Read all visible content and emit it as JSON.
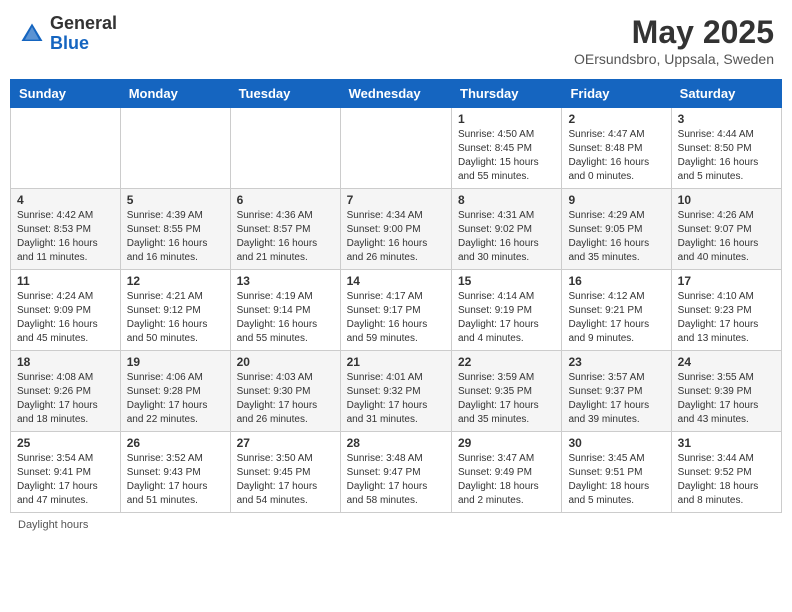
{
  "header": {
    "logo_general": "General",
    "logo_blue": "Blue",
    "month_year": "May 2025",
    "location": "OErsundsbro, Uppsala, Sweden"
  },
  "days_of_week": [
    "Sunday",
    "Monday",
    "Tuesday",
    "Wednesday",
    "Thursday",
    "Friday",
    "Saturday"
  ],
  "weeks": [
    [
      {
        "day": "",
        "info": ""
      },
      {
        "day": "",
        "info": ""
      },
      {
        "day": "",
        "info": ""
      },
      {
        "day": "",
        "info": ""
      },
      {
        "day": "1",
        "info": "Sunrise: 4:50 AM\nSunset: 8:45 PM\nDaylight: 15 hours\nand 55 minutes."
      },
      {
        "day": "2",
        "info": "Sunrise: 4:47 AM\nSunset: 8:48 PM\nDaylight: 16 hours\nand 0 minutes."
      },
      {
        "day": "3",
        "info": "Sunrise: 4:44 AM\nSunset: 8:50 PM\nDaylight: 16 hours\nand 5 minutes."
      }
    ],
    [
      {
        "day": "4",
        "info": "Sunrise: 4:42 AM\nSunset: 8:53 PM\nDaylight: 16 hours\nand 11 minutes."
      },
      {
        "day": "5",
        "info": "Sunrise: 4:39 AM\nSunset: 8:55 PM\nDaylight: 16 hours\nand 16 minutes."
      },
      {
        "day": "6",
        "info": "Sunrise: 4:36 AM\nSunset: 8:57 PM\nDaylight: 16 hours\nand 21 minutes."
      },
      {
        "day": "7",
        "info": "Sunrise: 4:34 AM\nSunset: 9:00 PM\nDaylight: 16 hours\nand 26 minutes."
      },
      {
        "day": "8",
        "info": "Sunrise: 4:31 AM\nSunset: 9:02 PM\nDaylight: 16 hours\nand 30 minutes."
      },
      {
        "day": "9",
        "info": "Sunrise: 4:29 AM\nSunset: 9:05 PM\nDaylight: 16 hours\nand 35 minutes."
      },
      {
        "day": "10",
        "info": "Sunrise: 4:26 AM\nSunset: 9:07 PM\nDaylight: 16 hours\nand 40 minutes."
      }
    ],
    [
      {
        "day": "11",
        "info": "Sunrise: 4:24 AM\nSunset: 9:09 PM\nDaylight: 16 hours\nand 45 minutes."
      },
      {
        "day": "12",
        "info": "Sunrise: 4:21 AM\nSunset: 9:12 PM\nDaylight: 16 hours\nand 50 minutes."
      },
      {
        "day": "13",
        "info": "Sunrise: 4:19 AM\nSunset: 9:14 PM\nDaylight: 16 hours\nand 55 minutes."
      },
      {
        "day": "14",
        "info": "Sunrise: 4:17 AM\nSunset: 9:17 PM\nDaylight: 16 hours\nand 59 minutes."
      },
      {
        "day": "15",
        "info": "Sunrise: 4:14 AM\nSunset: 9:19 PM\nDaylight: 17 hours\nand 4 minutes."
      },
      {
        "day": "16",
        "info": "Sunrise: 4:12 AM\nSunset: 9:21 PM\nDaylight: 17 hours\nand 9 minutes."
      },
      {
        "day": "17",
        "info": "Sunrise: 4:10 AM\nSunset: 9:23 PM\nDaylight: 17 hours\nand 13 minutes."
      }
    ],
    [
      {
        "day": "18",
        "info": "Sunrise: 4:08 AM\nSunset: 9:26 PM\nDaylight: 17 hours\nand 18 minutes."
      },
      {
        "day": "19",
        "info": "Sunrise: 4:06 AM\nSunset: 9:28 PM\nDaylight: 17 hours\nand 22 minutes."
      },
      {
        "day": "20",
        "info": "Sunrise: 4:03 AM\nSunset: 9:30 PM\nDaylight: 17 hours\nand 26 minutes."
      },
      {
        "day": "21",
        "info": "Sunrise: 4:01 AM\nSunset: 9:32 PM\nDaylight: 17 hours\nand 31 minutes."
      },
      {
        "day": "22",
        "info": "Sunrise: 3:59 AM\nSunset: 9:35 PM\nDaylight: 17 hours\nand 35 minutes."
      },
      {
        "day": "23",
        "info": "Sunrise: 3:57 AM\nSunset: 9:37 PM\nDaylight: 17 hours\nand 39 minutes."
      },
      {
        "day": "24",
        "info": "Sunrise: 3:55 AM\nSunset: 9:39 PM\nDaylight: 17 hours\nand 43 minutes."
      }
    ],
    [
      {
        "day": "25",
        "info": "Sunrise: 3:54 AM\nSunset: 9:41 PM\nDaylight: 17 hours\nand 47 minutes."
      },
      {
        "day": "26",
        "info": "Sunrise: 3:52 AM\nSunset: 9:43 PM\nDaylight: 17 hours\nand 51 minutes."
      },
      {
        "day": "27",
        "info": "Sunrise: 3:50 AM\nSunset: 9:45 PM\nDaylight: 17 hours\nand 54 minutes."
      },
      {
        "day": "28",
        "info": "Sunrise: 3:48 AM\nSunset: 9:47 PM\nDaylight: 17 hours\nand 58 minutes."
      },
      {
        "day": "29",
        "info": "Sunrise: 3:47 AM\nSunset: 9:49 PM\nDaylight: 18 hours\nand 2 minutes."
      },
      {
        "day": "30",
        "info": "Sunrise: 3:45 AM\nSunset: 9:51 PM\nDaylight: 18 hours\nand 5 minutes."
      },
      {
        "day": "31",
        "info": "Sunrise: 3:44 AM\nSunset: 9:52 PM\nDaylight: 18 hours\nand 8 minutes."
      }
    ]
  ],
  "footer": {
    "note": "Daylight hours"
  }
}
